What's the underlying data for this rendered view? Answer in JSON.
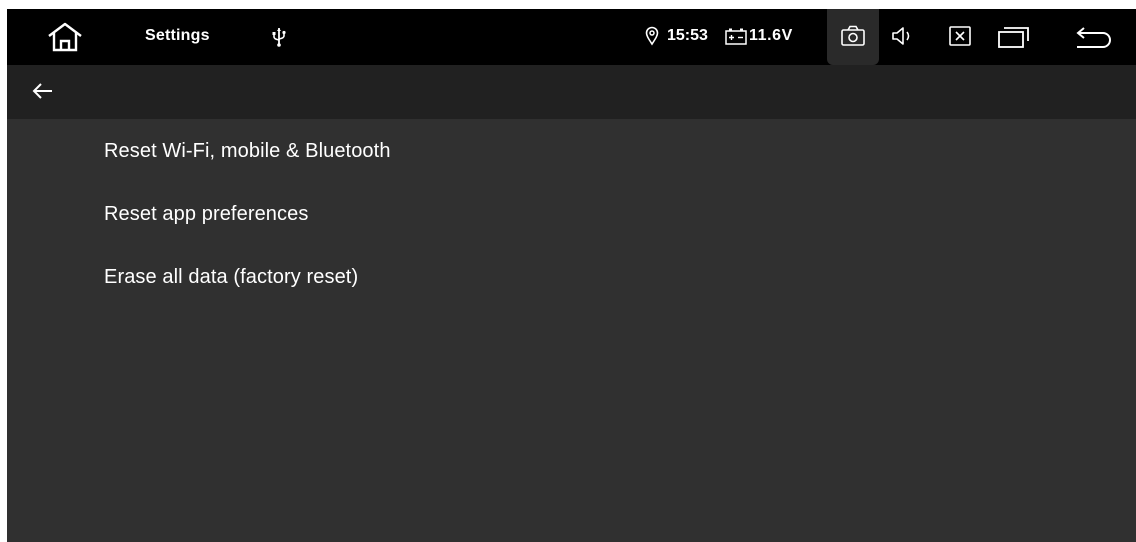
{
  "status_bar": {
    "home_icon": "home-icon",
    "app_title": "Settings",
    "usb_icon": "usb-icon",
    "location_icon": "location-icon",
    "time": "15:53",
    "battery_icon": "battery-icon",
    "voltage": "11.6V",
    "camera_icon": "camera-icon",
    "volume_icon": "volume-icon",
    "close_app_icon": "close-app-icon",
    "recents_icon": "recents-icon",
    "back_icon": "back-icon"
  },
  "app_bar": {
    "back_icon": "arrow-left-icon"
  },
  "reset_options": [
    {
      "label": "Reset Wi-Fi, mobile & Bluetooth"
    },
    {
      "label": "Reset app preferences"
    },
    {
      "label": "Erase all data (factory reset)"
    }
  ],
  "colors": {
    "status_bar_bg": "#000000",
    "app_bar_bg": "#212121",
    "content_bg": "#303030",
    "text": "#ffffff"
  }
}
